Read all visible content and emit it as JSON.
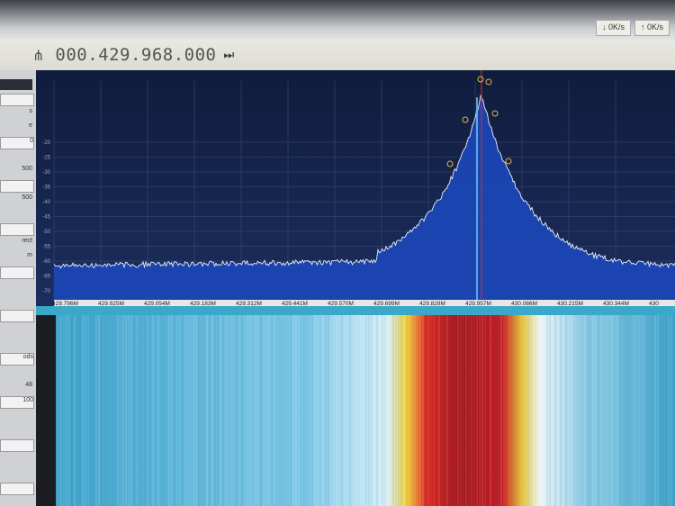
{
  "header": {
    "chip_a": "↓ 0K/s",
    "chip_b": "↑ 0K/s"
  },
  "frequency": {
    "display": "000.429.968.000",
    "tune_icon": "tune-icon",
    "skip_icon": "skip-forward-icon"
  },
  "left_panel": {
    "items": [
      "",
      "",
      "s",
      "e",
      "0",
      "",
      "500",
      "",
      "500",
      "",
      "",
      "rect",
      "m",
      "",
      "",
      "",
      "",
      "",
      "",
      "ods",
      "",
      "48",
      "100",
      "",
      "",
      "",
      "",
      "",
      ""
    ]
  },
  "spectrum": {
    "y_ticks": [
      "-20",
      "-25",
      "-30",
      "-35",
      "-40",
      "-45",
      "-50",
      "-55",
      "-60",
      "-65",
      "-70"
    ],
    "x_ticks": [
      "429.796M",
      "429.925M",
      "429.054M",
      "429.183M",
      "429.312M",
      "429.441M",
      "429.570M",
      "429.699M",
      "429.828M",
      "429.957M",
      "430.086M",
      "430.215M",
      "430.344M",
      "430"
    ],
    "center_freq": "429.957M"
  },
  "colors": {
    "spectrum_bg": "#0d1a3a",
    "fill": "#1b47b8",
    "trace": "#e9eef8",
    "marker": "#e0b34a",
    "cursor": "#d0342c",
    "waterfall_bg": "#3aa8c8",
    "signal_hot": "#c0161c"
  }
}
